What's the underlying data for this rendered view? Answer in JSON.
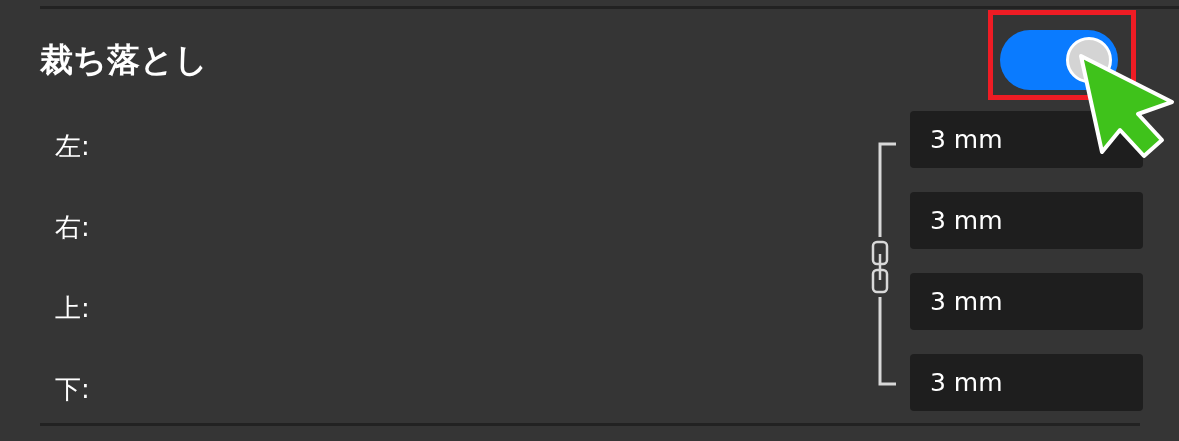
{
  "section": {
    "title": "裁ち落とし",
    "toggle": {
      "on": true
    }
  },
  "linked": true,
  "fields": [
    {
      "label": "左:",
      "value": "3 mm"
    },
    {
      "label": "右:",
      "value": "3 mm"
    },
    {
      "label": "上:",
      "value": "3 mm"
    },
    {
      "label": "下:",
      "value": "3 mm"
    }
  ]
}
